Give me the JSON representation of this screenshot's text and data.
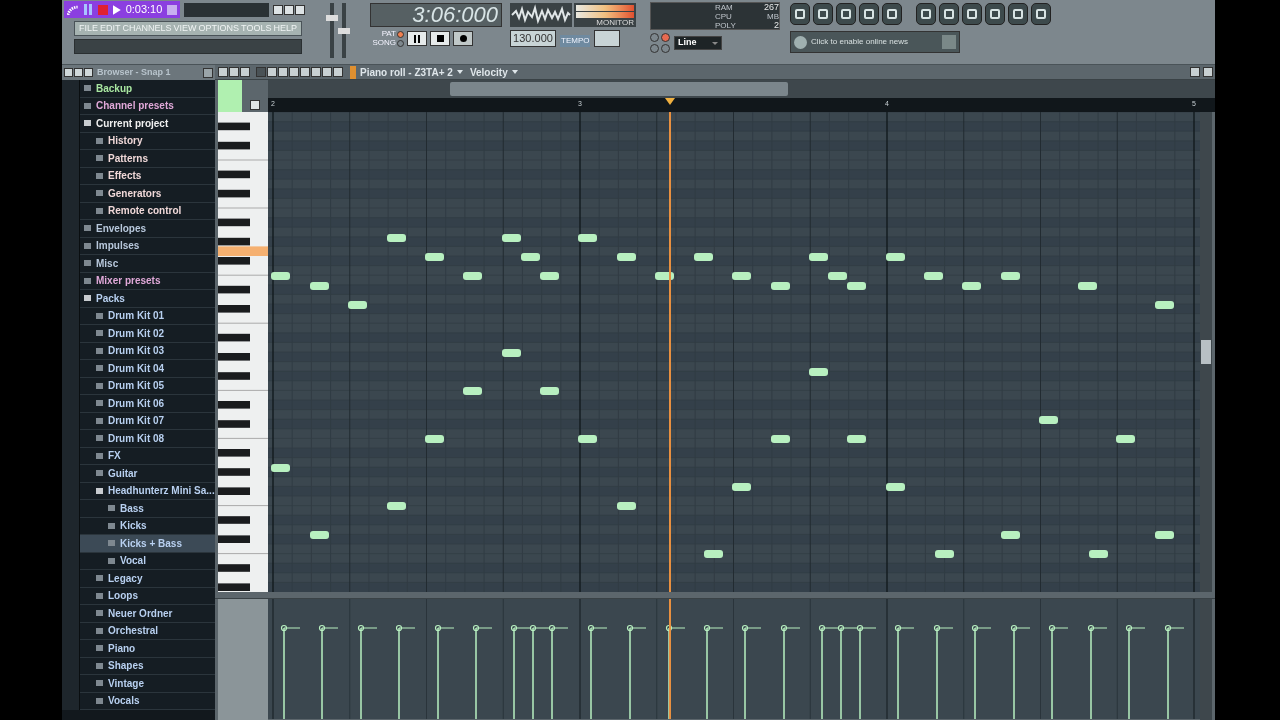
{
  "transport": {
    "song_time": "0:03:10"
  },
  "mixer": {
    "volume": {
      "level": 0.75
    },
    "pitch": {
      "level": 0.5
    }
  },
  "menu": [
    "FILE",
    "EDIT",
    "CHANNELS",
    "VIEW",
    "OPTIONS",
    "TOOLS",
    "HELP"
  ],
  "clock": {
    "time": "3:06:000"
  },
  "mode": [
    {
      "label": "PAT",
      "selected": true
    },
    {
      "label": "SONG",
      "selected": false
    }
  ],
  "tempo": {
    "value": "130.000",
    "label": "TEMPO"
  },
  "monitor": {
    "label": "MONITOR"
  },
  "cpu_panel": {
    "ram_label": "RAM",
    "mb": "267",
    "mb_label": "MB",
    "cpu_label": "CPU",
    "poly_label": "POLY",
    "poly": "2"
  },
  "snap": {
    "value": "Line"
  },
  "news": {
    "text": "Click to enable online news"
  },
  "browser": {
    "title": "Browser - Snap 1",
    "items": [
      {
        "label": "Backup",
        "color": "#a8e6a0"
      },
      {
        "label": "Channel presets",
        "color": "#e0a8d8"
      },
      {
        "label": "Current project",
        "color": "#f0f0f0",
        "expanded": true,
        "children": [
          {
            "label": "History",
            "color": "#f0d8d8"
          },
          {
            "label": "Patterns",
            "color": "#f0d8d8"
          },
          {
            "label": "Effects",
            "color": "#f0d8d8"
          },
          {
            "label": "Generators",
            "color": "#f0d8d8"
          },
          {
            "label": "Remote control",
            "color": "#f0d8d8"
          }
        ]
      },
      {
        "label": "Envelopes",
        "color": "#b8c8dc"
      },
      {
        "label": "Impulses",
        "color": "#b8c8dc"
      },
      {
        "label": "Misc",
        "color": "#b8c8dc"
      },
      {
        "label": "Mixer presets",
        "color": "#e0a8d8"
      },
      {
        "label": "Packs",
        "color": "#b8d0f0",
        "expanded": true,
        "children": [
          {
            "label": "Drum Kit 01",
            "color": "#b8d0f0",
            "selected": false
          },
          {
            "label": "Drum Kit 02",
            "color": "#b8d0f0",
            "selected": false
          },
          {
            "label": "Drum Kit 03",
            "color": "#b8d0f0",
            "selected": false
          },
          {
            "label": "Drum Kit 04",
            "color": "#b8d0f0",
            "selected": false
          },
          {
            "label": "Drum Kit 05",
            "color": "#b8d0f0",
            "selected": false
          },
          {
            "label": "Drum Kit 06",
            "color": "#b8d0f0",
            "selected": false
          },
          {
            "label": "Drum Kit 07",
            "color": "#b8d0f0",
            "selected": false
          },
          {
            "label": "Drum Kit 08",
            "color": "#b8d0f0",
            "selected": false
          },
          {
            "label": "FX",
            "color": "#b8d0f0",
            "selected": false
          },
          {
            "label": "Guitar",
            "color": "#b8d0f0",
            "selected": false
          },
          {
            "label": "Headhunterz Mini Sa...",
            "color": "#b8d0f0",
            "selected": false,
            "expanded": true,
            "children": [
              {
                "label": "Bass",
                "color": "#b8d0f0",
                "selected": false
              },
              {
                "label": "Kicks",
                "color": "#b8d0f0",
                "selected": false
              },
              {
                "label": "Kicks + Bass",
                "color": "#b8d0f0",
                "selected": true
              },
              {
                "label": "Vocal",
                "color": "#b8d0f0",
                "selected": false
              }
            ]
          },
          {
            "label": "Legacy",
            "color": "#b8d0f0",
            "selected": false
          },
          {
            "label": "Loops",
            "color": "#b8d0f0",
            "selected": false
          },
          {
            "label": "Neuer Ordner",
            "color": "#b8d0f0",
            "selected": false
          },
          {
            "label": "Orchestral",
            "color": "#b8d0f0",
            "selected": false
          },
          {
            "label": "Piano",
            "color": "#b8d0f0",
            "selected": false
          },
          {
            "label": "Shapes",
            "color": "#b8d0f0",
            "selected": false
          },
          {
            "label": "Vintage",
            "color": "#b8d0f0",
            "selected": false
          },
          {
            "label": "Vocals",
            "color": "#b8d0f0",
            "selected": false
          }
        ]
      }
    ]
  },
  "piano_roll": {
    "title": "Piano roll - Z3TA+ 2",
    "lane": "Velocity",
    "bars": [
      "2",
      "3",
      "4",
      "5"
    ]
  }
}
